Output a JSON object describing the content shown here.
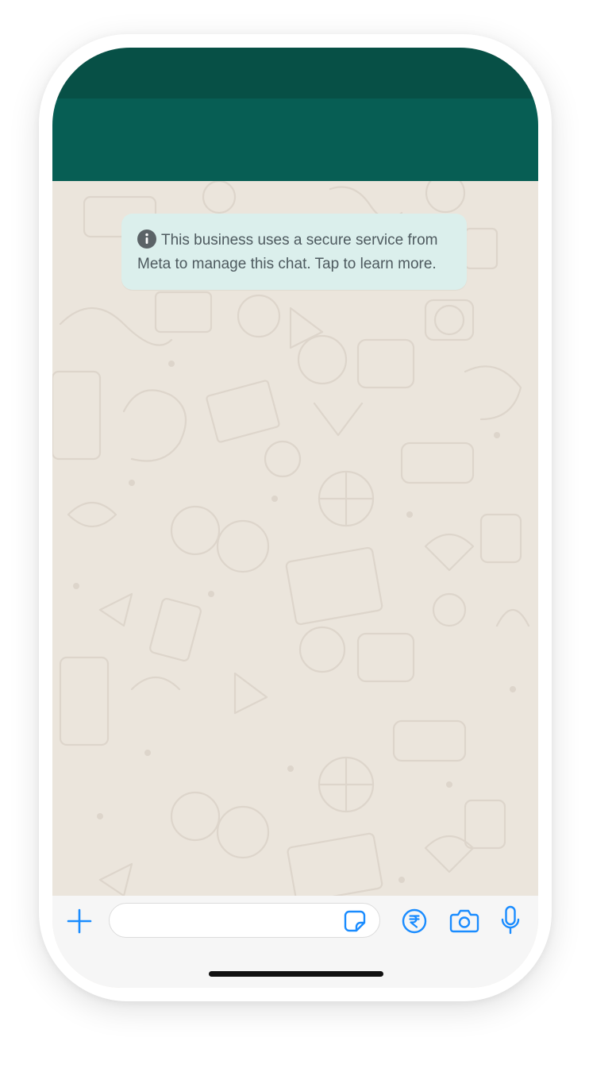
{
  "colors": {
    "status_bar": "#075046",
    "header": "#075e54",
    "chat_background": "#ebe5dc",
    "notice_background": "#dbefec",
    "notice_text": "#4e5a5f",
    "icon_accent": "#1a8cff",
    "composer_background": "#f6f6f6"
  },
  "chat": {
    "notice": {
      "icon": "info-icon",
      "text": "This business uses a secure service from Meta to manage this chat. Tap to learn more."
    }
  },
  "composer": {
    "input_value": "",
    "icons": [
      "plus-icon",
      "sticker-icon",
      "rupee-payment-icon",
      "camera-icon",
      "microphone-icon"
    ]
  }
}
